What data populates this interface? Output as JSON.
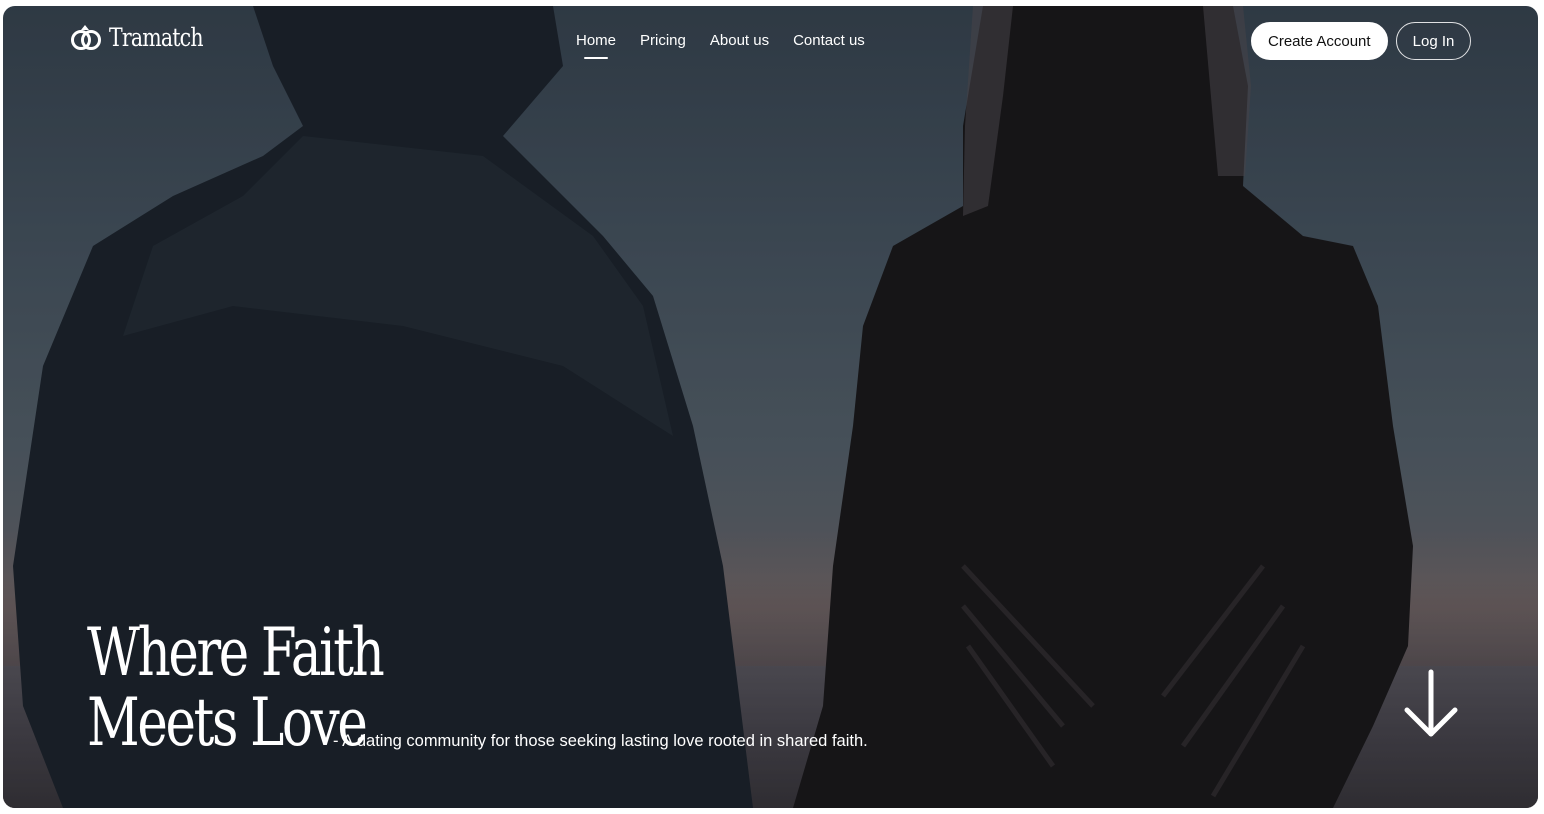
{
  "brand": {
    "name": "Tramatch",
    "logo_icon": "interlocked-rings-icon"
  },
  "nav": {
    "items": [
      {
        "label": "Home",
        "active": true
      },
      {
        "label": "Pricing",
        "active": false
      },
      {
        "label": "About us",
        "active": false
      },
      {
        "label": "Contact us",
        "active": false
      }
    ],
    "create_account_label": "Create Account",
    "login_label": "Log In"
  },
  "hero": {
    "headline_line1": "Where Faith",
    "headline_line2": "Meets Love",
    "tagline": "- A dating community for those seeking lasting love rooted in shared faith.",
    "scroll_icon": "arrow-down-icon",
    "background_image": "silhouette of couple holding hands at sunset by the sea"
  },
  "colors": {
    "text": "#ffffff",
    "button_bg": "#ffffff",
    "button_text": "#111111"
  }
}
